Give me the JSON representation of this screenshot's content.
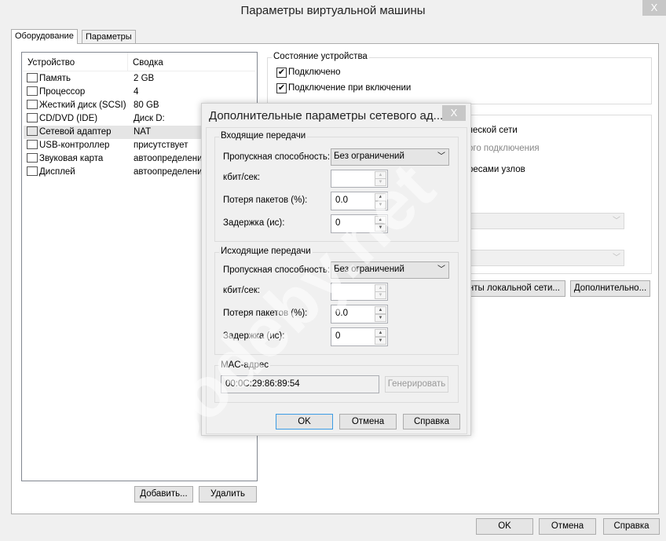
{
  "window": {
    "title": "Параметры виртуальной машины",
    "close": "X"
  },
  "tabs": [
    {
      "label": "Оборудование"
    },
    {
      "label": "Параметры"
    }
  ],
  "devices": {
    "headers": [
      "Устройство",
      "Сводка"
    ],
    "rows": [
      {
        "device": "Память",
        "summary": "2 GB",
        "icon": "memory-icon"
      },
      {
        "device": "Процессор",
        "summary": "4",
        "icon": "cpu-icon"
      },
      {
        "device": "Жесткий диск (SCSI)",
        "summary": "80 GB",
        "icon": "harddisk-icon"
      },
      {
        "device": "CD/DVD (IDE)",
        "summary": "Диск D:",
        "icon": "cd-icon"
      },
      {
        "device": "Сетевой адаптер",
        "summary": "NAT",
        "icon": "network-icon"
      },
      {
        "device": "USB-контроллер",
        "summary": "присутствует",
        "icon": "usb-icon"
      },
      {
        "device": "Звуковая карта",
        "summary": "автоопределение",
        "icon": "speaker-icon"
      },
      {
        "device": "Дисплей",
        "summary": "автоопределение",
        "icon": "monitor-icon"
      }
    ]
  },
  "list_buttons": {
    "add": "Добавить...",
    "remove": "Удалить"
  },
  "device_status": {
    "title": "Состояние устройства",
    "connected": "Подключено",
    "connect_on_power": "Подключение при включении"
  },
  "network": {
    "opt1": "ческой сети",
    "opt2": "ого подключения",
    "opt3": "ресами узлов",
    "lan_segments": "нты локальной сети...",
    "advanced": "Дополнительно..."
  },
  "footer": {
    "ok": "OK",
    "cancel": "Отмена",
    "help": "Справка"
  },
  "dialog": {
    "title": "Дополнительные параметры сетевого ад...",
    "close": "X",
    "incoming": {
      "title": "Входящие передачи",
      "bandwidth_label": "Пропускная способность:",
      "bandwidth": "Без ограничений",
      "kbps_label": "кбит/сек:",
      "kbps": "",
      "loss_label": "Потеря пакетов (%):",
      "loss": "0.0",
      "latency_label": "Задержка (ис):",
      "latency": "0"
    },
    "outgoing": {
      "title": "Исходящие передачи",
      "bandwidth_label": "Пропускная способность:",
      "bandwidth": "Без ограничений",
      "kbps_label": "кбит/сек:",
      "kbps": "",
      "loss_label": "Потеря пакетов (%):",
      "loss": "0.0",
      "latency_label": "Задержка (ис):",
      "latency": "0"
    },
    "mac": {
      "title": "MAC-адрес",
      "value": "00:0C:29:86:89:54",
      "generate": "Генерировать"
    },
    "ok": "OK",
    "cancel": "Отмена",
    "help": "Справка"
  },
  "watermark": "codeby.net"
}
